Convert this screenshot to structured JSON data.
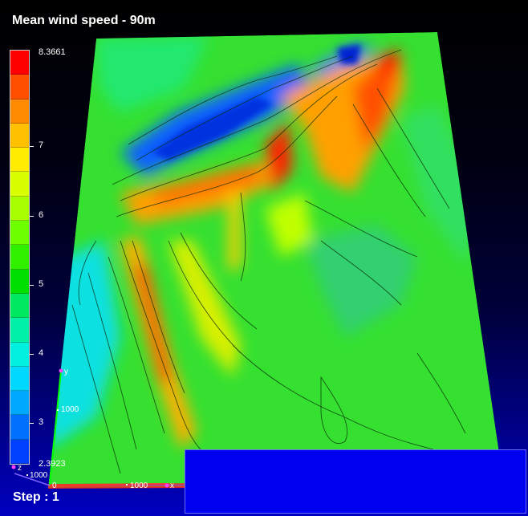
{
  "title": "Mean wind speed - 90m",
  "colorbar": {
    "max_label": "8.3661",
    "min_label": "2.3923",
    "ticks": [
      "7",
      "6",
      "5",
      "4",
      "3"
    ],
    "colors": [
      "#ff0000",
      "#ff5000",
      "#ff8c00",
      "#ffc000",
      "#ffec00",
      "#d8ff00",
      "#a8ff00",
      "#6cff00",
      "#30f000",
      "#00e000",
      "#00e860",
      "#00f0a8",
      "#00f0e0",
      "#00d8ff",
      "#00a8ff",
      "#0070ff",
      "#0040ff"
    ]
  },
  "axes": {
    "y_letter": "y",
    "z_letter": "z",
    "x_letter": "x",
    "origin_label": "0",
    "y_tick": "1000",
    "z_tick": "1000",
    "x_tick": "1000"
  },
  "step_label": "Step : 1"
}
